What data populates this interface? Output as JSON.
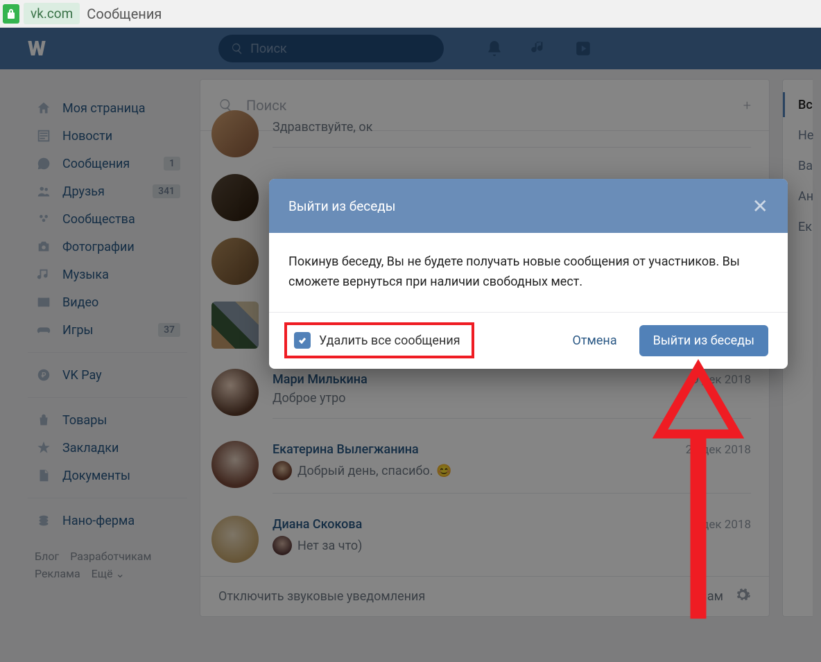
{
  "browser": {
    "domain": "vk.com",
    "title": "Сообщения"
  },
  "header": {
    "search_placeholder": "Поиск"
  },
  "sidebar": {
    "items": [
      {
        "label": "Моя страница"
      },
      {
        "label": "Новости"
      },
      {
        "label": "Сообщения",
        "badge": "1"
      },
      {
        "label": "Друзья",
        "badge": "341"
      },
      {
        "label": "Сообщества"
      },
      {
        "label": "Фотографии"
      },
      {
        "label": "Музыка"
      },
      {
        "label": "Видео"
      },
      {
        "label": "Игры",
        "badge": "37"
      },
      {
        "label": "VK Pay"
      },
      {
        "label": "Товары"
      },
      {
        "label": "Закладки"
      },
      {
        "label": "Документы"
      },
      {
        "label": "Нано-ферма"
      }
    ],
    "footer": [
      "Блог",
      "Разработчикам",
      "Реклама",
      "Ещё ⌄"
    ]
  },
  "main": {
    "search_placeholder": "Поиск",
    "conversations": [
      {
        "name": "",
        "msg": "Здравствуйте, ок",
        "date": ""
      },
      {
        "name": "",
        "msg": "",
        "date": ""
      },
      {
        "name": "",
        "msg": "",
        "date": ""
      },
      {
        "name": "",
        "msg": "",
        "date": ""
      },
      {
        "name": "Мари Милькина",
        "msg": "Доброе утро",
        "date": "9 дек 2018"
      },
      {
        "name": "Екатерина Вылегжанина",
        "msg": "Добрый день, спасибо. 😊",
        "date": "27 дек 2018"
      },
      {
        "name": "Диана Скокова",
        "msg": "Нет за что)",
        "date": "9 дек 2018"
      }
    ],
    "mute_label": "Отключить звуковые уведомления",
    "spam_label": "Спам"
  },
  "right_tabs": [
    "Вс",
    "Не",
    "Ва",
    "Ан",
    "Ек"
  ],
  "modal": {
    "title": "Выйти из беседы",
    "body": "Покинув беседу, Вы не будете получать новые сообщения от участников. Вы сможете вернуться при наличии свободных мест.",
    "checkbox_label": "Удалить все сообщения",
    "cancel": "Отмена",
    "confirm": "Выйти из беседы"
  }
}
